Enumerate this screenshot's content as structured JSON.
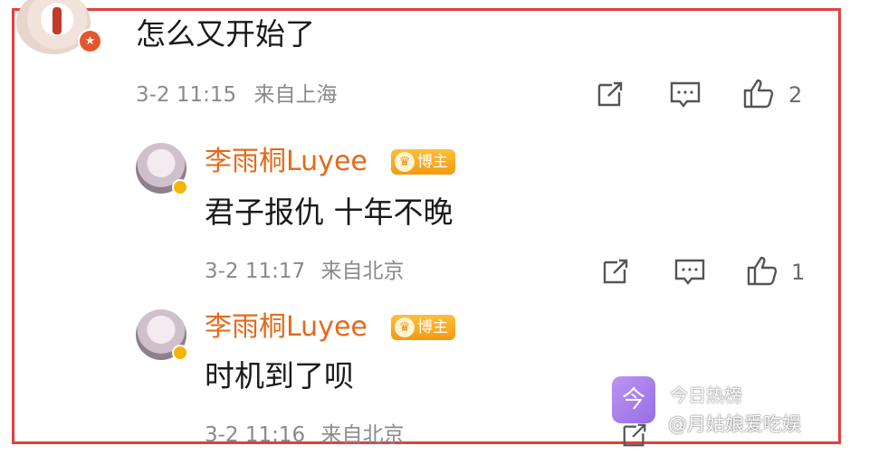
{
  "top_comment": {
    "text": "怎么又开始了",
    "time": "3-2 11:15",
    "location": "来自上海",
    "like_count": "2",
    "badge_icon": "star-badge-icon"
  },
  "replies": [
    {
      "username": "李雨桐Luyee",
      "badge_label": "博主",
      "text": "君子报仇 十年不晚",
      "time": "3-2 11:17",
      "location": "来自北京",
      "like_count": "1"
    },
    {
      "username": "李雨桐Luyee",
      "badge_label": "博主",
      "text": "时机到了呗",
      "time": "3-2 11:16",
      "location": "来自北京"
    }
  ],
  "watermark": {
    "logo_char": "今",
    "title": "今日热榜",
    "user": "@月姑娘爱吃娱"
  },
  "colors": {
    "frame": "#e0403f",
    "username": "#e36a1a",
    "meta": "#8a8a8a"
  }
}
